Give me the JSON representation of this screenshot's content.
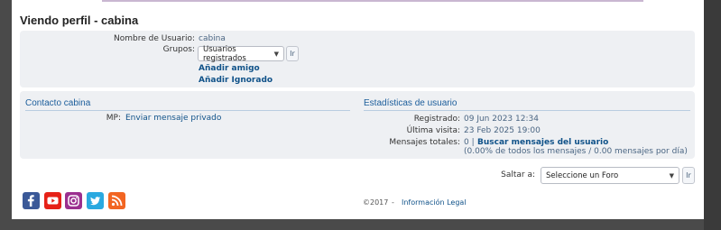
{
  "profile": {
    "title": "Viendo perfil - cabina",
    "username_label": "Nombre de Usuario:",
    "username": "cabina",
    "groups_label": "Grupos:",
    "groups_selected": "Usuarios registrados",
    "go_label": "Ir",
    "add_friend": "Añadir amigo",
    "add_ignored": "Añadir Ignorado"
  },
  "contact": {
    "title": "Contacto cabina",
    "pm_label": "MP:",
    "pm_link": "Enviar mensaje privado"
  },
  "stats": {
    "title": "Estadísticas de usuario",
    "registered_label": "Registrado:",
    "registered": "09 Jun 2023 12:34",
    "last_visit_label": "Última visita:",
    "last_visit": "23 Feb 2025 19:00",
    "posts_label": "Mensajes totales:",
    "posts_count": "0 |",
    "search_posts": "Buscar mensajes del usuario",
    "posts_detail": "(0.00% de todos los mensajes / 0.00 mensajes por día)"
  },
  "jump": {
    "label": "Saltar a:",
    "selected": "Seleccione un Foro",
    "go_label": "Ir"
  },
  "footer": {
    "copyright": "©2017",
    "separator": "-",
    "legal": "Información Legal"
  },
  "social_icons": [
    "facebook-icon",
    "youtube-icon",
    "instagram-icon",
    "twitter-icon",
    "rss-icon"
  ],
  "colors": {
    "link": "#105289",
    "accent_title": "#1b5d9b",
    "panel_bg": "#eef0f3",
    "facebook": "#3b5998",
    "youtube": "#e62117",
    "twitter": "#2aa9e0",
    "rss": "#f26522"
  }
}
